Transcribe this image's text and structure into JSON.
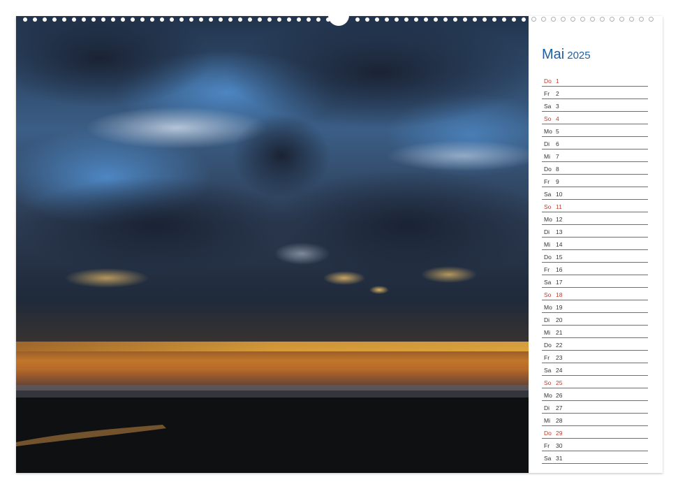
{
  "calendar": {
    "month": "Mai",
    "year": "2025",
    "days": [
      {
        "wd": "Do",
        "d": "1",
        "red": true
      },
      {
        "wd": "Fr",
        "d": "2",
        "red": false
      },
      {
        "wd": "Sa",
        "d": "3",
        "red": false
      },
      {
        "wd": "So",
        "d": "4",
        "red": true
      },
      {
        "wd": "Mo",
        "d": "5",
        "red": false
      },
      {
        "wd": "Di",
        "d": "6",
        "red": false
      },
      {
        "wd": "Mi",
        "d": "7",
        "red": false
      },
      {
        "wd": "Do",
        "d": "8",
        "red": false
      },
      {
        "wd": "Fr",
        "d": "9",
        "red": false
      },
      {
        "wd": "Sa",
        "d": "10",
        "red": false
      },
      {
        "wd": "So",
        "d": "11",
        "red": true
      },
      {
        "wd": "Mo",
        "d": "12",
        "red": false
      },
      {
        "wd": "Di",
        "d": "13",
        "red": false
      },
      {
        "wd": "Mi",
        "d": "14",
        "red": false
      },
      {
        "wd": "Do",
        "d": "15",
        "red": false
      },
      {
        "wd": "Fr",
        "d": "16",
        "red": false
      },
      {
        "wd": "Sa",
        "d": "17",
        "red": false
      },
      {
        "wd": "So",
        "d": "18",
        "red": true
      },
      {
        "wd": "Mo",
        "d": "19",
        "red": false
      },
      {
        "wd": "Di",
        "d": "20",
        "red": false
      },
      {
        "wd": "Mi",
        "d": "21",
        "red": false
      },
      {
        "wd": "Do",
        "d": "22",
        "red": false
      },
      {
        "wd": "Fr",
        "d": "23",
        "red": false
      },
      {
        "wd": "Sa",
        "d": "24",
        "red": false
      },
      {
        "wd": "So",
        "d": "25",
        "red": true
      },
      {
        "wd": "Mo",
        "d": "26",
        "red": false
      },
      {
        "wd": "Di",
        "d": "27",
        "red": false
      },
      {
        "wd": "Mi",
        "d": "28",
        "red": false
      },
      {
        "wd": "Do",
        "d": "29",
        "red": true
      },
      {
        "wd": "Fr",
        "d": "30",
        "red": false
      },
      {
        "wd": "Sa",
        "d": "31",
        "red": false
      }
    ]
  },
  "colors": {
    "accent": "#1f5fa0",
    "line": "#3b7bbd",
    "holiday": "#c0392b"
  }
}
